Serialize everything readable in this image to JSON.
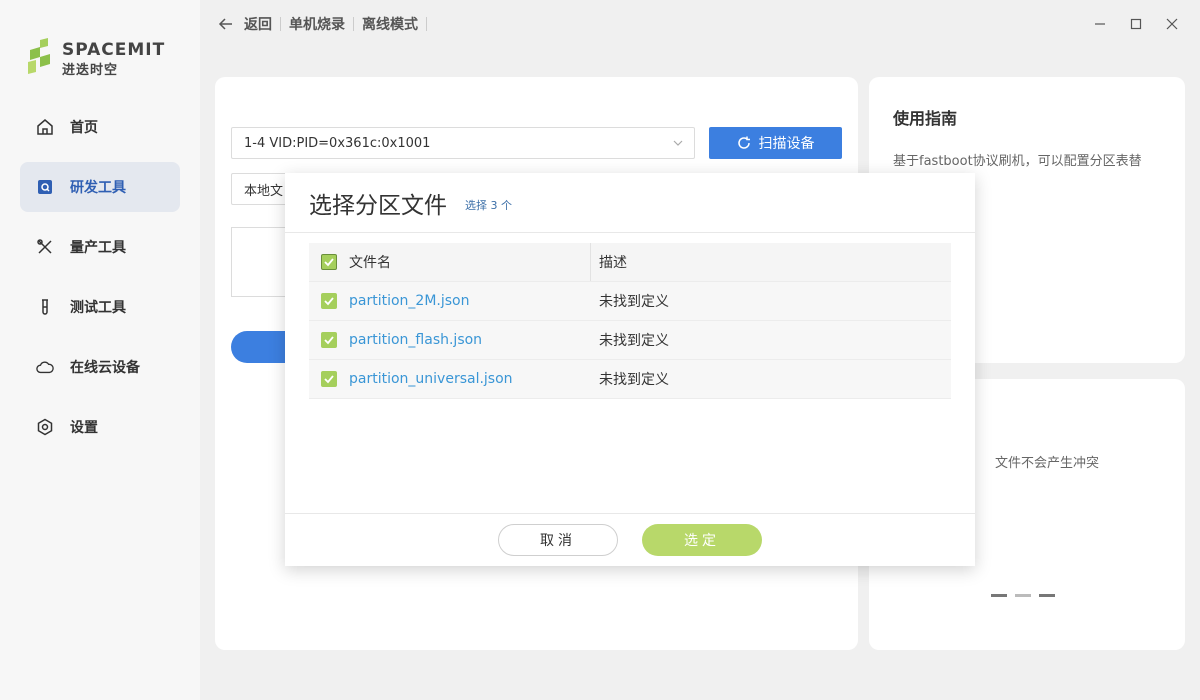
{
  "app": {
    "logo_text": "SPACEMIT",
    "logo_sub": "进迭时空"
  },
  "sidebar": {
    "items": [
      {
        "label": "首页",
        "icon": "home-icon"
      },
      {
        "label": "研发工具",
        "icon": "dev-tools-icon",
        "active": true
      },
      {
        "label": "量产工具",
        "icon": "production-tools-icon"
      },
      {
        "label": "测试工具",
        "icon": "test-tube-icon"
      },
      {
        "label": "在线云设备",
        "icon": "cloud-icon"
      },
      {
        "label": "设置",
        "icon": "settings-icon"
      }
    ]
  },
  "topbar": {
    "back": "返回",
    "crumb1": "单机烧录",
    "crumb2": "离线模式"
  },
  "main": {
    "device_value": "1-4 VID:PID=0x361c:0x1001",
    "scan_label": "扫描设备",
    "source_value": "本地文"
  },
  "guide": {
    "title": "使用指南",
    "desc": "基于fastboot协议刷机，可以配置分区表替"
  },
  "tip": {
    "text": "文件不会产生冲突"
  },
  "modal": {
    "title": "选择分区文件",
    "count": "选择 3 个",
    "columns": {
      "name": "文件名",
      "desc": "描述"
    },
    "rows": [
      {
        "name": "partition_2M.json",
        "desc": "未找到定义"
      },
      {
        "name": "partition_flash.json",
        "desc": "未找到定义"
      },
      {
        "name": "partition_universal.json",
        "desc": "未找到定义"
      }
    ],
    "cancel": "取消",
    "ok": "选定"
  },
  "colors": {
    "accent": "#3c7fe0",
    "check": "#a5cf5c",
    "ok_button": "#b8d86a",
    "link": "#3a96d6"
  }
}
